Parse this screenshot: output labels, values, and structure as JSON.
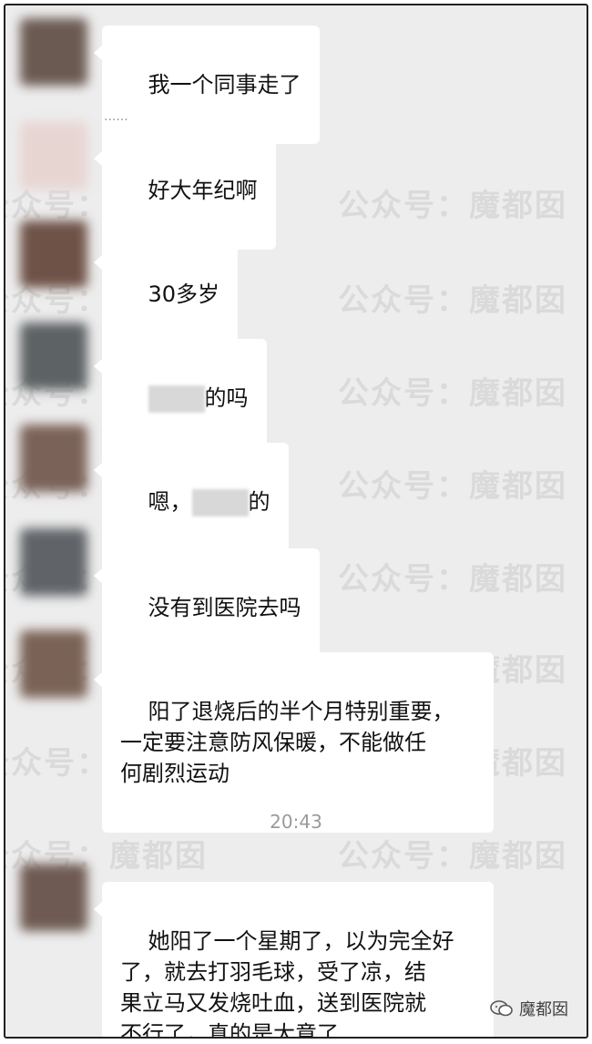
{
  "badge": {
    "text": "魔都囡",
    "icon": "wechat-chat-icon"
  },
  "watermark": "公众号：魔都囡",
  "separator_time": "20:43",
  "messages": [
    {
      "text": "我一个同事走了"
    },
    {
      "text": "好大年纪啊",
      "name": "......"
    },
    {
      "text": "30多岁"
    },
    {
      "prefix": "",
      "suffix": "的吗"
    },
    {
      "prefix": "嗯，",
      "suffix": "的"
    },
    {
      "text": "没有到医院去吗"
    },
    {
      "text": "阳了退烧后的半个月特别重要，\n一定要注意防风保暖，不能做任\n何剧烈运动"
    },
    {
      "text": "她阳了一个星期了，以为完全好\n了，就去打羽毛球，受了凉，结\n果立马又发烧吐血，送到医院就\n不行了，真的是大意了"
    }
  ]
}
